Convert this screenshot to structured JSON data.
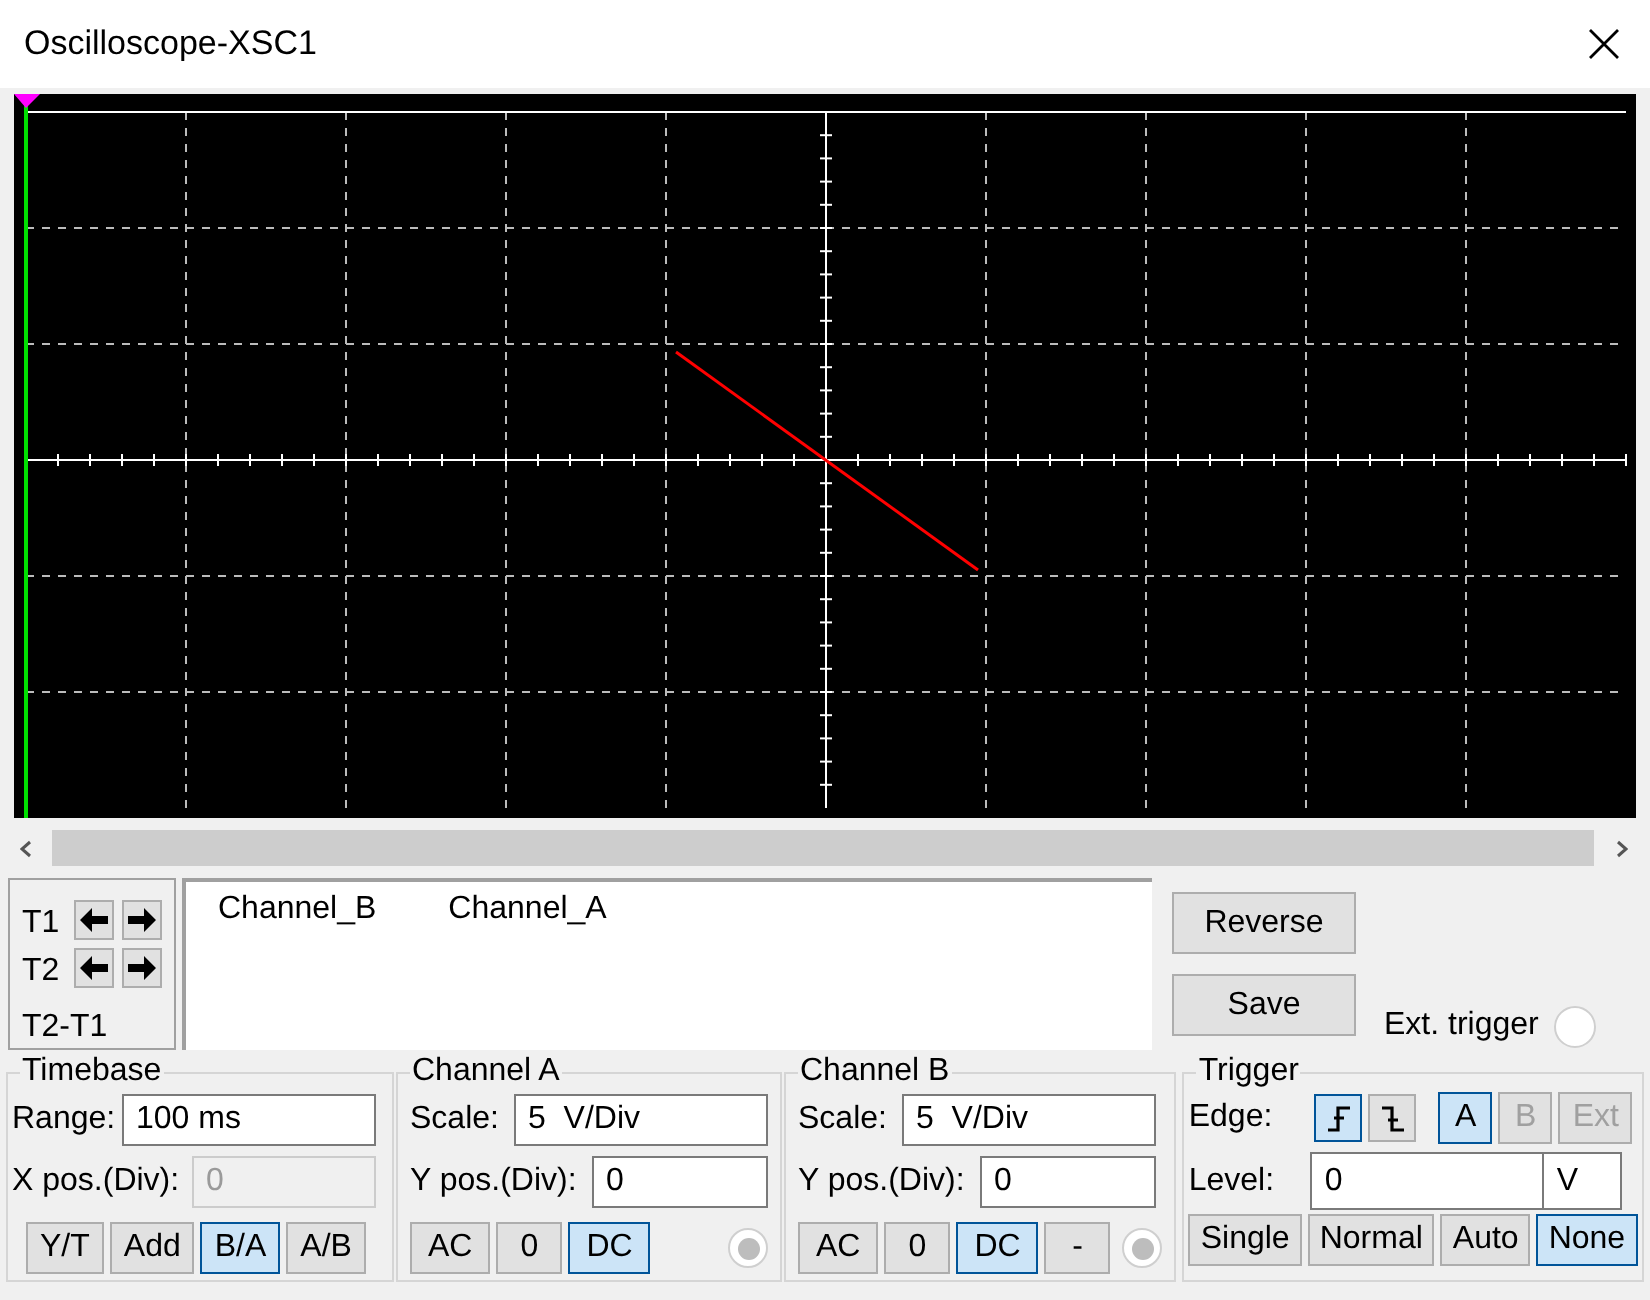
{
  "window": {
    "title": "Oscilloscope-XSC1"
  },
  "cursors": [
    {
      "label": "T1"
    },
    {
      "label": "T2"
    }
  ],
  "cursor_diff": "T2-T1",
  "readout": {
    "columns": [
      "Channel_B",
      "Channel_A"
    ]
  },
  "buttons": [
    {
      "label": "Reverse"
    },
    {
      "label": "Save"
    }
  ],
  "ext_trigger": {
    "label": "Ext. trigger"
  },
  "timebase": {
    "title": "Timebase",
    "range_label": "Range:",
    "range": "100 ms",
    "xpos_label": "X pos.(Div):",
    "xpos": "0",
    "xpos_disabled": true,
    "modes": [
      {
        "label": "Y/T",
        "selected": false
      },
      {
        "label": "Add",
        "selected": false
      },
      {
        "label": "B/A",
        "selected": true
      },
      {
        "label": "A/B",
        "selected": false
      }
    ]
  },
  "channels": [
    {
      "title": "Channel A",
      "scale_label": "Scale:",
      "scale": "5  V/Div",
      "ypos_label": "Y pos.(Div):",
      "ypos": "0",
      "coupling": [
        {
          "label": "AC",
          "selected": false
        },
        {
          "label": "0",
          "selected": false
        },
        {
          "label": "DC",
          "selected": true
        }
      ]
    },
    {
      "title": "Channel B",
      "scale_label": "Scale:",
      "scale": "5  V/Div",
      "ypos_label": "Y pos.(Div):",
      "ypos": "0",
      "coupling": [
        {
          "label": "AC",
          "selected": false
        },
        {
          "label": "0",
          "selected": false
        },
        {
          "label": "DC",
          "selected": true
        },
        {
          "label": "-",
          "selected": false
        }
      ]
    }
  ],
  "trigger": {
    "title": "Trigger",
    "edge_label": "Edge:",
    "edges": [
      {
        "kind": "rising",
        "selected": true
      },
      {
        "kind": "falling",
        "selected": false
      }
    ],
    "sources": [
      {
        "label": "A",
        "selected": true,
        "disabled": false
      },
      {
        "label": "B",
        "selected": false,
        "disabled": true
      },
      {
        "label": "Ext",
        "selected": false,
        "disabled": true
      }
    ],
    "level_label": "Level:",
    "level": "0",
    "level_unit": "V",
    "modes": [
      {
        "label": "Single",
        "selected": false
      },
      {
        "label": "Normal",
        "selected": false
      },
      {
        "label": "Auto",
        "selected": false
      },
      {
        "label": "None",
        "selected": true
      }
    ]
  }
}
